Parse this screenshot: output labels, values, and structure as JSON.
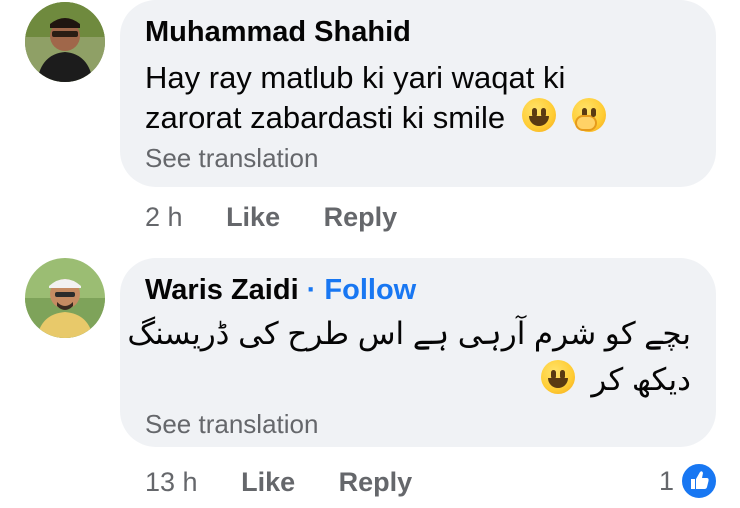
{
  "comments": [
    {
      "author": "Muhammad Shahid",
      "lines": [
        "Hay ray matlub ki yari waqat ki",
        "zarorat zabardasti ki smile"
      ],
      "see_translation": "See translation",
      "time": "2 h",
      "like": "Like",
      "reply": "Reply"
    },
    {
      "author": "Waris Zaidi",
      "follow_sep": " · ",
      "follow": "Follow",
      "lines": [
        "بچے کو شرم آرہی ہے اس طرح کی ڈریسنگ",
        "دیکھ کر"
      ],
      "see_translation": "See translation",
      "time": "13 h",
      "like": "Like",
      "reply": "Reply",
      "reaction_count": "1"
    }
  ],
  "colors": {
    "bubble": "#f0f2f5",
    "link": "#1877f2",
    "secondary_text": "#65676b"
  },
  "icons": [
    "grinning-emoji-icon",
    "face-with-hand-over-mouth-emoji-icon",
    "like-reaction-icon"
  ]
}
